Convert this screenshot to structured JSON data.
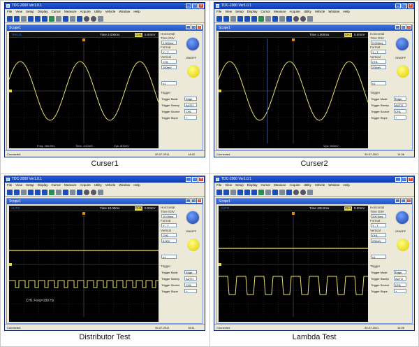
{
  "captions": [
    "Curser1",
    "Curser2",
    "Distributor Test",
    "Lambda Test"
  ],
  "app_title": "TDC-2000 Ver1.0.1",
  "menu": [
    "File",
    "View",
    "Setup",
    "Display",
    "Cursor",
    "Measure",
    "Acquire",
    "Utility",
    "Vehicle",
    "Window",
    "Help"
  ],
  "window_buttons": {
    "minimize": "_",
    "maximize": "□",
    "close": "×"
  },
  "child_title": "Scope1",
  "colors": {
    "trace": "#e8e070",
    "cursor_blue": "#3a6cd0",
    "grid": "#3a3a3a",
    "knob_yellow": "#f2e600",
    "knob_blue": "#1a3c9c"
  },
  "panels": [
    {
      "scope_status": "TRIG'D",
      "timebase": "Time 2.000ms",
      "channel": "CH1",
      "volts": "5.00mV",
      "foot_freq": "Freq: 250.5Hz",
      "foot_time": "Time: 4.00mS",
      "foot_vpp": "Vpk: 800mV",
      "side": {
        "horizontal": "Horizontal",
        "time_div_label": "Time /DIV",
        "time_div": "2.000ms",
        "format_label": "Format",
        "format": "Y - T",
        "vertical": "Vertical",
        "ch_select": "CH1",
        "volt_div": "200mV",
        "onoff": "ON/OFF",
        "probe": "x1"
      },
      "trigger": {
        "title": "Trigger",
        "mode_label": "Trigger Mode",
        "mode": "Edge",
        "sweep_label": "Trigger Sweep",
        "sweep": "AUTO",
        "source_label": "Trigger Source",
        "source": "CH1",
        "slope_label": "Trigger Slope",
        "slope": "+"
      },
      "status": {
        "left": "Connected",
        "date": "30-07-2011",
        "time": "14:42"
      }
    },
    {
      "scope_status": "",
      "timebase": "Time 1.000ms",
      "channel": "CH1",
      "volts": "0.00mV",
      "foot_freq": "",
      "foot_time": "",
      "foot_vpp": "Vpk: 250mV",
      "side": {
        "horizontal": "Horizontal",
        "time_div_label": "Time /DIV",
        "time_div": "2.000ms",
        "format_label": "Format",
        "format": "Y - T",
        "vertical": "Vertical",
        "ch_select": "CH1",
        "volt_div": "200mV",
        "onoff": "ON/OFF",
        "probe": "x1"
      },
      "trigger": {
        "title": "Trigger",
        "mode_label": "Trigger Mode",
        "mode": "Edge",
        "sweep_label": "Trigger Sweep",
        "sweep": "AUTO",
        "source_label": "Trigger Source",
        "source": "CH1",
        "slope_label": "Trigger Slope",
        "slope": "+"
      },
      "status": {
        "left": "Connected",
        "date": "30-07-2011",
        "time": "14:36"
      }
    },
    {
      "scope_status": "AUTO",
      "timebase": "Time 10.00ms",
      "channel": "CH1",
      "volts": "0.00mV",
      "foot_freq": "",
      "foot_time": "",
      "foot_vpp": "",
      "annotation": "CH1 Freq=180 Hz",
      "side": {
        "horizontal": "Horizontal",
        "time_div_label": "Time /DIV",
        "time_div": "10.00ms",
        "format_label": "Format",
        "format": "Y - T",
        "vertical": "Vertical",
        "ch_select": "CH1",
        "volt_div": "5.00V",
        "onoff": "ON/OFF",
        "probe": "x1"
      },
      "trigger": {
        "title": "Trigger",
        "mode_label": "Trigger Mode",
        "mode": "Edge",
        "sweep_label": "Trigger Sweep",
        "sweep": "AUTO",
        "source_label": "Trigger Source",
        "source": "CH1",
        "slope_label": "Trigger Slope",
        "slope": "+"
      },
      "status": {
        "left": "Connected",
        "date": "30-07-2011",
        "time": "15:11"
      }
    },
    {
      "scope_status": "AUTO",
      "timebase": "Time 200.0ms",
      "channel": "CH1",
      "volts": "0.00mV",
      "foot_freq": "",
      "foot_time": "",
      "foot_vpp": "",
      "side": {
        "horizontal": "Horizontal",
        "time_div_label": "Time /DIV",
        "time_div": "200.0ms",
        "format_label": "Format",
        "format": "Y - T",
        "vertical": "Vertical",
        "ch_select": "CH1",
        "volt_div": "200mV",
        "onoff": "ON/OFF",
        "probe": "x1"
      },
      "trigger": {
        "title": "Trigger",
        "mode_label": "Trigger Mode",
        "mode": "Edge",
        "sweep_label": "Trigger Sweep",
        "sweep": "AUTO",
        "source_label": "Trigger Source",
        "source": "CH1",
        "slope_label": "Trigger Slope",
        "slope": "+"
      },
      "status": {
        "left": "Connected",
        "date": "30-07-2011",
        "time": "15:35"
      }
    }
  ]
}
